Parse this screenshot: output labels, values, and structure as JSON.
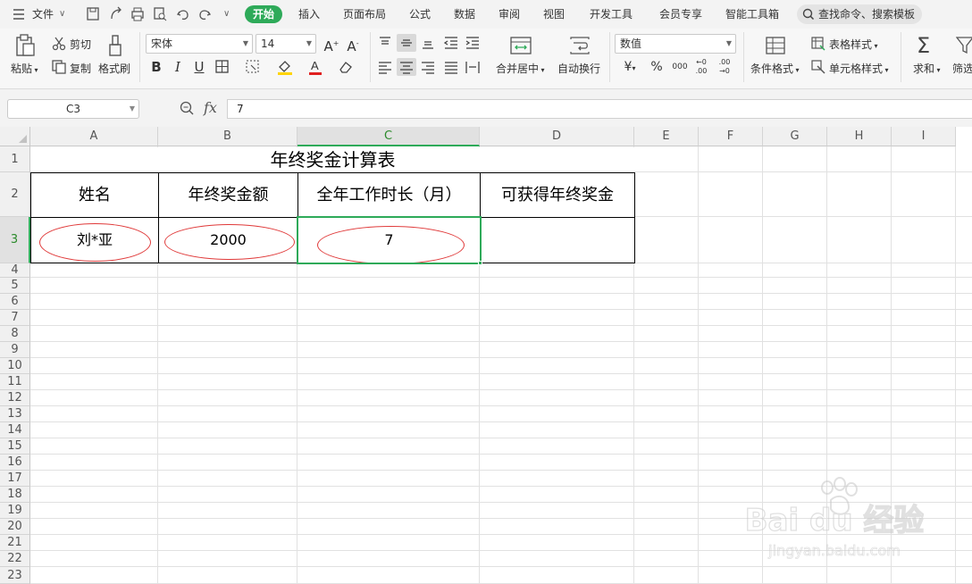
{
  "menubar": {
    "file": "文件",
    "tabs": [
      "开始",
      "插入",
      "页面布局",
      "公式",
      "数据",
      "审阅",
      "视图",
      "开发工具",
      "会员专享",
      "智能工具箱"
    ],
    "search_placeholder": "查找命令、搜索模板"
  },
  "ribbon": {
    "paste": "粘贴",
    "cut": "剪切",
    "copy": "复制",
    "format_painter": "格式刷",
    "font_name": "宋体",
    "font_size": "14",
    "merge_center": "合并居中",
    "wrap_text": "自动换行",
    "number_format": "数值",
    "conditional_format": "条件格式",
    "table_style": "表格样式",
    "cell_style": "单元格样式",
    "sum": "求和",
    "filter": "筛选"
  },
  "formula_bar": {
    "name_box": "C3",
    "fx": "fx",
    "value": "7"
  },
  "sheet": {
    "columns": [
      "A",
      "B",
      "C",
      "D",
      "E",
      "F",
      "G",
      "H",
      "I"
    ],
    "selected_column": "C",
    "rows": [
      "1",
      "2",
      "3",
      "4",
      "5",
      "6",
      "7",
      "8",
      "9",
      "10",
      "11",
      "12",
      "13",
      "14",
      "15",
      "16",
      "17",
      "18",
      "19",
      "20",
      "21",
      "22",
      "23"
    ],
    "selected_row": "3",
    "title": "年终奖金计算表",
    "headers": [
      "姓名",
      "年终奖金额",
      "全年工作时长（月）",
      "可获得年终奖金"
    ],
    "data": [
      "刘*亚",
      "2000",
      "7",
      ""
    ]
  },
  "watermark": {
    "brand": "Bai du 经验",
    "url": "jingyan.baidu.com"
  },
  "colors": {
    "accent": "#2eaa59",
    "oval": "#e03a3a"
  }
}
